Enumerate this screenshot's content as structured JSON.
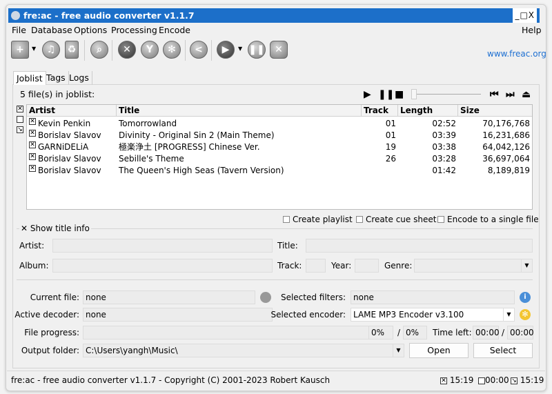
{
  "window": {
    "title": "fre:ac - free audio converter v1.1.7",
    "controls": "_□X"
  },
  "menu": [
    "File",
    "Database",
    "Options",
    "Processing",
    "Encode"
  ],
  "help": "Help",
  "toolbar": {
    "website": "www.freac.org",
    "icons": [
      "add-files-icon",
      "add-audio-cd-icon",
      "remove-icon",
      "cddb-query-icon",
      "configure-icon",
      "filters-icon",
      "encoder-settings-icon",
      "share-icon",
      "start-encoding-icon",
      "pause-icon",
      "stop-icon"
    ]
  },
  "tabs": [
    "Joblist",
    "Tags",
    "Logs"
  ],
  "joblist": {
    "count_label": "5 file(s) in joblist:",
    "columns": [
      "Artist",
      "Title",
      "Track",
      "Length",
      "Size"
    ],
    "rows": [
      {
        "artist": "Kevin Penkin",
        "title": "Tomorrowland",
        "track": "01",
        "length": "02:52",
        "size": "70,176,768",
        "checked": true
      },
      {
        "artist": "Borislav Slavov",
        "title": "Divinity - Original Sin 2 (Main Theme)",
        "track": "01",
        "length": "03:39",
        "size": "16,231,686",
        "checked": true
      },
      {
        "artist": "GARNiDELiA",
        "title": "極楽浄土 [PROGRESS] Chinese Ver.",
        "track": "19",
        "length": "03:38",
        "size": "64,042,126",
        "checked": true
      },
      {
        "artist": "Borislav Slavov",
        "title": "Sebille's Theme",
        "track": "26",
        "length": "03:28",
        "size": "36,697,064",
        "checked": true
      },
      {
        "artist": "Borislav Slavov",
        "title": "The Queen's High Seas (Tavern Version)",
        "track": "",
        "length": "01:42",
        "size": "8,189,819",
        "checked": true
      }
    ],
    "options": [
      "Create playlist",
      "Create cue sheet",
      "Encode to a single file"
    ]
  },
  "title_info": {
    "toggle": "Show title info",
    "artist": "Artist:",
    "title": "Title:",
    "album": "Album:",
    "track": "Track:",
    "year": "Year:",
    "genre": "Genre:"
  },
  "status_panel": {
    "current_file_label": "Current file:",
    "current_file": "none",
    "filters_label": "Selected filters:",
    "filters": "none",
    "decoder_label": "Active decoder:",
    "decoder": "none",
    "encoder_label": "Selected encoder:",
    "encoder": "LAME MP3 Encoder v3.100",
    "progress_label": "File progress:",
    "file_progress": "0%",
    "total_progress": "0%",
    "slash": "/",
    "time_left_label": "Time left:",
    "time_left": "00:00",
    "time_total": "00:00",
    "output_label": "Output folder:",
    "output_folder": "C:\\Users\\yangh\\Music\\",
    "open": "Open",
    "select": "Select"
  },
  "statusbar": {
    "text": "fre:ac - free audio converter v1.1.7 - Copyright (C) 2001-2023 Robert Kausch",
    "t1": "15:19",
    "t2": "00:00",
    "t3": "15:19"
  },
  "colors": {
    "titlebar": "#1c6fc9",
    "link": "#1d6fd1"
  }
}
